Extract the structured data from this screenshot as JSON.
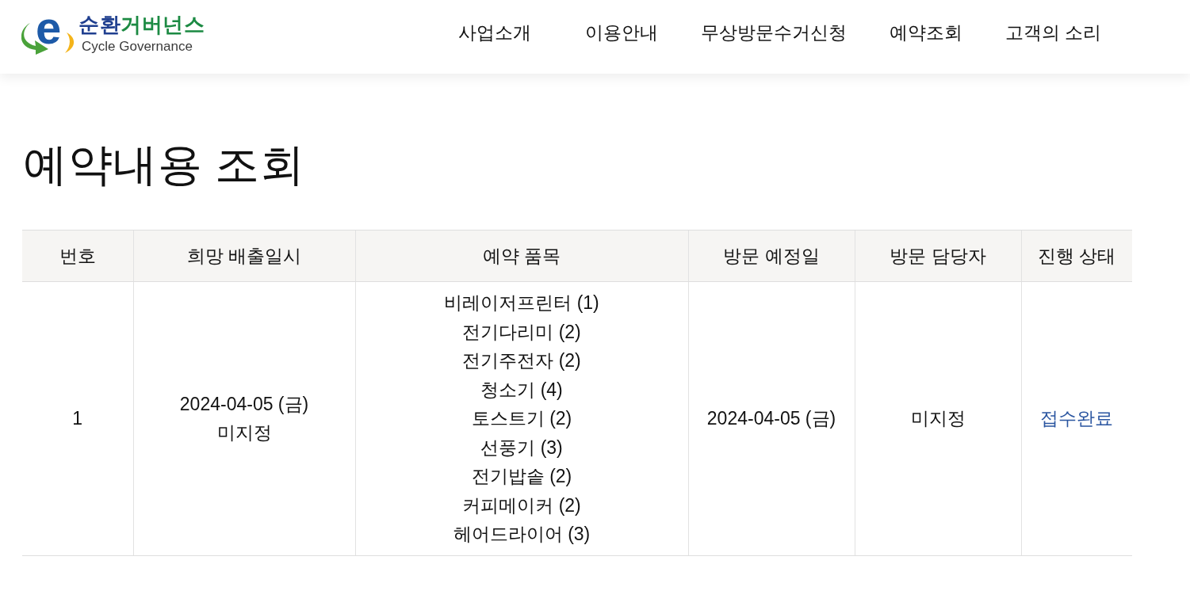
{
  "header": {
    "logo": {
      "mark": "e",
      "title_parts": [
        "순환",
        "거버넌스"
      ],
      "subtitle": "Cycle Governance"
    },
    "nav": [
      "사업소개",
      "이용안내",
      "무상방문수거신청",
      "예약조회",
      "고객의 소리"
    ]
  },
  "page_title": "예약내용 조회",
  "table": {
    "columns": [
      "번호",
      "희망 배출일시",
      "예약 품목",
      "방문 예정일",
      "방문 담당자",
      "진행 상태"
    ],
    "rows": [
      {
        "number": "1",
        "desired_date": "2024-04-05 (금)",
        "desired_time": "미지정",
        "items": [
          "비레이저프린터 (1)",
          "전기다리미 (2)",
          "전기주전자 (2)",
          "청소기 (4)",
          "토스트기 (2)",
          "선풍기 (3)",
          "전기밥솥 (2)",
          "커피메이커 (2)",
          "헤어드라이어 (3)"
        ],
        "visit_date": "2024-04-05 (금)",
        "assignee": "미지정",
        "status": "접수완료"
      }
    ]
  }
}
